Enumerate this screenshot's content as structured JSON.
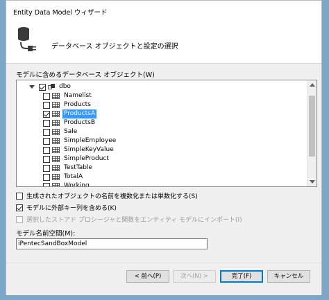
{
  "window": {
    "title": "Entity Data Model ウィザード"
  },
  "header": {
    "heading": "データベース オブジェクトと設定の選択",
    "icon": "database-connector-icon"
  },
  "objects": {
    "label": "モデルに含めるデータベース オブジェクト(W)",
    "schema": {
      "name": "dbo",
      "state": "partial",
      "expanded": true
    },
    "tables": [
      {
        "name": "Namelist",
        "checked": false,
        "selected": false
      },
      {
        "name": "Products",
        "checked": false,
        "selected": false
      },
      {
        "name": "ProductsA",
        "checked": true,
        "selected": true
      },
      {
        "name": "ProductsB",
        "checked": false,
        "selected": false
      },
      {
        "name": "Sale",
        "checked": false,
        "selected": false
      },
      {
        "name": "SimpleEmployee",
        "checked": false,
        "selected": false
      },
      {
        "name": "SimpleKeyValue",
        "checked": false,
        "selected": false
      },
      {
        "name": "SimpleProduct",
        "checked": false,
        "selected": false
      },
      {
        "name": "TestTable",
        "checked": false,
        "selected": false
      },
      {
        "name": "TotalA",
        "checked": false,
        "selected": false
      },
      {
        "name": "Working",
        "checked": false,
        "selected": false
      }
    ]
  },
  "options": {
    "pluralize": {
      "label": "生成されたオブジェクトの名前を複数化または単数化する(S)",
      "checked": false,
      "enabled": true
    },
    "foreign_keys": {
      "label": "モデルに外部キー列を含める(K)",
      "checked": true,
      "enabled": true
    },
    "import_procs": {
      "label": "選択したストアド プロシージャと関数をエンティティ モデルにインポート(I)",
      "checked": false,
      "enabled": false
    }
  },
  "namespace": {
    "label": "モデル名前空間(M):",
    "value": "iPentecSandBoxModel"
  },
  "buttons": {
    "back": "< 前へ(P)",
    "next": "次へ(N) >",
    "finish": "完了(F)",
    "cancel": "キャンセル"
  }
}
